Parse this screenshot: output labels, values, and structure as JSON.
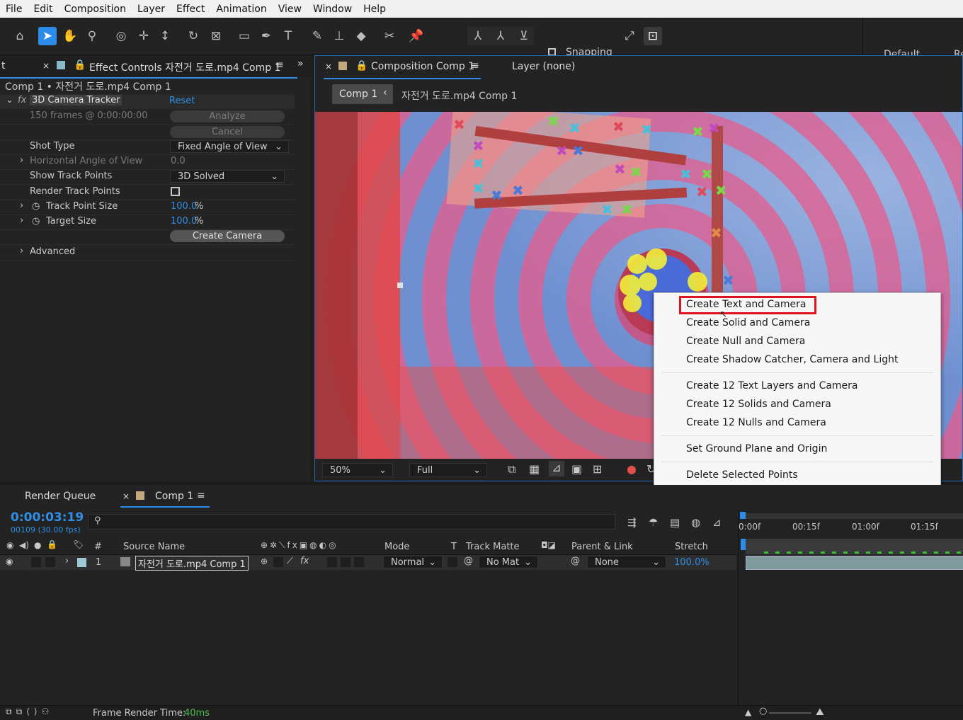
{
  "menu": [
    "File",
    "Edit",
    "Composition",
    "Layer",
    "Effect",
    "Animation",
    "View",
    "Window",
    "Help"
  ],
  "toolbar": {
    "snapping_label": "Snapping",
    "workspace_label": "Default",
    "workspace_next": "Re"
  },
  "effect_panel": {
    "tab_left_fragment": "t",
    "tab_label": "Effect Controls 자전거 도로.mp4 Comp 1",
    "breadcrumb": "Comp 1 • 자전거 도로.mp4 Comp 1",
    "effect_name": "3D Camera Tracker",
    "reset_label": "Reset",
    "frames_info": "150 frames @ 0:00:00:00",
    "analyze_label": "Analyze",
    "cancel_label": "Cancel",
    "shot_type_label": "Shot Type",
    "shot_type_value": "Fixed Angle of View",
    "hfov_label": "Horizontal Angle of View",
    "hfov_value": "0.0",
    "show_track_label": "Show Track Points",
    "show_track_value": "3D Solved",
    "render_track_label": "Render Track Points",
    "track_point_size_label": "Track Point Size",
    "track_point_size_value": "100.0",
    "target_size_label": "Target Size",
    "target_size_value": "100.0",
    "percent": "%",
    "create_camera_label": "Create Camera",
    "advanced_label": "Advanced"
  },
  "comp_panel": {
    "tab_label": "Composition Comp 1",
    "layer_label": "Layer (none)",
    "crumb_comp": "Comp 1",
    "crumb_layer": "자전거 도로.mp4 Comp 1",
    "zoom": "50%",
    "resolution": "Full"
  },
  "context_menu": {
    "items": [
      "Create Text and Camera",
      "Create Solid and Camera",
      "Create Null and Camera",
      "Create Shadow Catcher, Camera and Light",
      "Create 12 Text Layers and Camera",
      "Create 12 Solids and Camera",
      "Create 12 Nulls and Camera",
      "Set Ground Plane and Origin",
      "Delete Selected Points"
    ],
    "highlight_color": "#e0141e"
  },
  "timeline": {
    "render_queue_label": "Render Queue",
    "comp_tab_label": "Comp 1",
    "timecode": "0:00:03:19",
    "frame_info": "00109 (30.00 fps)",
    "col_num": "#",
    "col_source": "Source Name",
    "col_mode": "Mode",
    "col_t": "T",
    "col_track_matte": "Track Matte",
    "col_parent": "Parent & Link",
    "col_stretch": "Stretch",
    "ruler": [
      "0:00f",
      "00:15f",
      "01:00f",
      "01:15f"
    ],
    "layer": {
      "num": "1",
      "name": "자전거 도로.mp4 Comp 1",
      "mode": "Normal",
      "matte": "No Mat",
      "parent": "None",
      "stretch": "100.0%"
    },
    "frame_render_label": "Frame Render Time:",
    "frame_render_value": "40ms"
  },
  "colors": {
    "accent": "#2d8ceb",
    "timecode": "#2e8fe6",
    "render_time": "#4fc04f"
  }
}
